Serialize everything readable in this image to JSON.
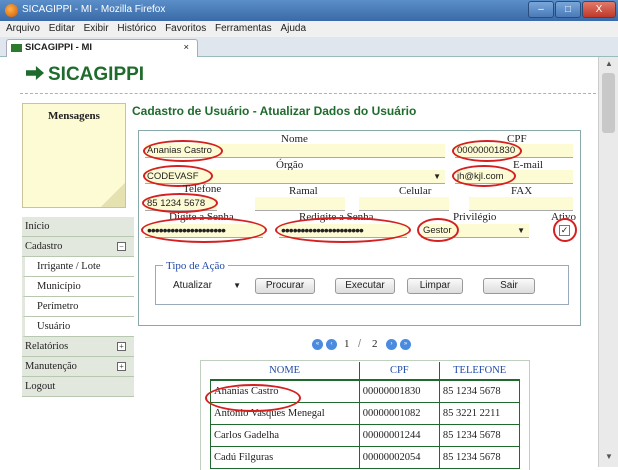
{
  "window": {
    "title": "SICAGIPPI - MI - Mozilla Firefox",
    "min": "–",
    "max": "□",
    "close": "X"
  },
  "menubar": [
    "Arquivo",
    "Editar",
    "Exibir",
    "Histórico",
    "Favoritos",
    "Ferramentas",
    "Ajuda"
  ],
  "tab": {
    "label": "SICAGIPPI - MI",
    "close": "×"
  },
  "app": {
    "logo": "SICAGIPPI"
  },
  "messages": {
    "title": "Mensagens"
  },
  "sidebar": {
    "items": [
      {
        "label": "Início"
      },
      {
        "label": "Cadastro",
        "toggle": "−"
      },
      {
        "label": "Irrigante / Lote",
        "sub": true
      },
      {
        "label": "Município",
        "sub": true
      },
      {
        "label": "Perímetro",
        "sub": true
      },
      {
        "label": "Usuário",
        "sub": true
      },
      {
        "label": "Relatórios",
        "toggle": "+"
      },
      {
        "label": "Manutenção",
        "toggle": "+"
      },
      {
        "label": "Logout"
      }
    ]
  },
  "page": {
    "heading": "Cadastro de Usuário - Atualizar Dados do Usuário"
  },
  "form": {
    "labels": {
      "nome": "Nome",
      "cpf": "CPF",
      "orgao": "Órgão",
      "email": "E-mail",
      "telefone": "Telefone",
      "ramal": "Ramal",
      "celular": "Celular",
      "fax": "FAX",
      "senha": "Digite a Senha",
      "resenha": "Redigite a Senha",
      "privilegio": "Privilégio",
      "ativo": "Ativo"
    },
    "values": {
      "nome": "Ananias Castro",
      "cpf": "00000001830",
      "orgao": "CODEVASF",
      "email": "jh@kjl.com",
      "telefone": "85 1234 5678",
      "senha": "••••••••••••••••••••",
      "resenha": "•••••••••••••••••••••",
      "privilegio": "Gestor",
      "ativo_check": "✓"
    },
    "acao": {
      "label": "Tipo de Ação",
      "select": "Atualizar",
      "buttons": [
        "Procurar",
        "Executar",
        "Limpar",
        "Sair"
      ]
    }
  },
  "pager": {
    "first": "«",
    "prev": "‹",
    "page1": "1",
    "sep": "/",
    "page2": "2",
    "next": "›",
    "last": "»"
  },
  "table": {
    "headers": [
      "NOME",
      "CPF",
      "TELEFONE"
    ],
    "rows": [
      [
        "Ananias Castro",
        "00000001830",
        "85 1234 5678"
      ],
      [
        "Antonio Vasques Menegal",
        "00000001082",
        "85 3221 2211"
      ],
      [
        "Carlos Gadelha",
        "00000001244",
        "85 1234 5678"
      ],
      [
        "Cadú Filguras",
        "00000002054",
        "85 1234 5678"
      ]
    ]
  },
  "colors": {
    "brand": "#1f6b2d",
    "highlight": "#d42020",
    "link": "#1f4aa8",
    "field": "#fdfbd4"
  }
}
